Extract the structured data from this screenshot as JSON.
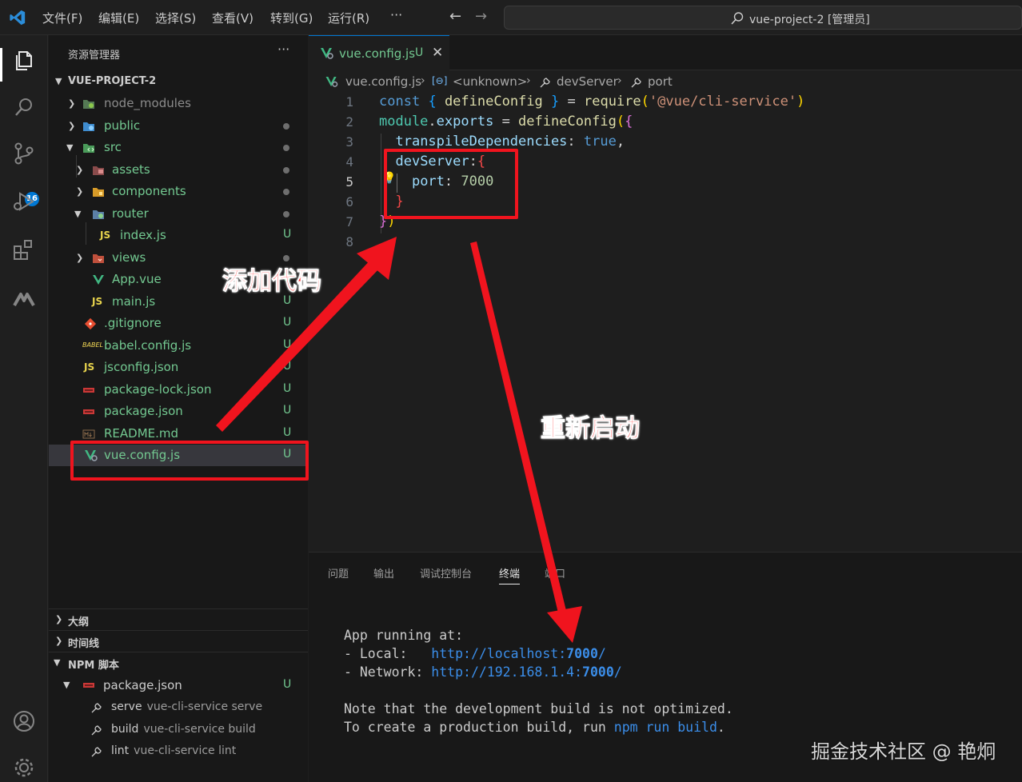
{
  "titlebar": {
    "menu": [
      "文件(F)",
      "编辑(E)",
      "选择(S)",
      "查看(V)",
      "转到(G)",
      "运行(R)"
    ],
    "more": "···",
    "command_center": "vue-project-2 [管理员]"
  },
  "activity": {
    "scm_badge": "16"
  },
  "sidebar": {
    "title": "资源管理器",
    "more": "···",
    "project": "VUE-PROJECT-2",
    "tree": [
      {
        "name": "node_modules",
        "status": ""
      },
      {
        "name": "public",
        "status": "•"
      },
      {
        "name": "src",
        "status": "•"
      },
      {
        "name": "assets",
        "status": "•"
      },
      {
        "name": "components",
        "status": "•"
      },
      {
        "name": "router",
        "status": "•"
      },
      {
        "name": "index.js",
        "status": "U"
      },
      {
        "name": "views",
        "status": "•"
      },
      {
        "name": "App.vue",
        "status": "U"
      },
      {
        "name": "main.js",
        "status": "U"
      },
      {
        "name": ".gitignore",
        "status": "U"
      },
      {
        "name": "babel.config.js",
        "status": "U"
      },
      {
        "name": "jsconfig.json",
        "status": "U"
      },
      {
        "name": "package-lock.json",
        "status": "U"
      },
      {
        "name": "package.json",
        "status": "U"
      },
      {
        "name": "README.md",
        "status": "U"
      },
      {
        "name": "vue.config.js",
        "status": "U"
      }
    ],
    "sections": {
      "outline": "大纲",
      "timeline": "时间线",
      "npm": "NPM 脚本"
    },
    "npm": {
      "file": "package.json",
      "file_status": "U",
      "scripts": [
        {
          "name": "serve",
          "cmd": "vue-cli-service serve"
        },
        {
          "name": "build",
          "cmd": "vue-cli-service build"
        },
        {
          "name": "lint",
          "cmd": "vue-cli-service lint"
        }
      ]
    }
  },
  "editor": {
    "tab": {
      "label": "vue.config.js",
      "status": "U",
      "close": "✕"
    },
    "breadcrumb": [
      "vue.config.js",
      "<unknown>",
      "devServer",
      "port"
    ],
    "line_numbers": [
      "1",
      "2",
      "3",
      "4",
      "5",
      "6",
      "7",
      "8"
    ]
  },
  "panel": {
    "tabs": [
      "问题",
      "输出",
      "调试控制台",
      "终端",
      "端口"
    ],
    "terminal": {
      "running": "App running at:",
      "local_label": "- Local:   ",
      "local_url_a": "http://localhost:",
      "local_port": "7000",
      "local_url_b": "/",
      "network_label": "- Network: ",
      "network_url_a": "http://192.168.1.4:",
      "network_port": "7000",
      "network_url_b": "/",
      "note": "Note that the development build is not optimized.",
      "prod_a": "To create a production build, run ",
      "prod_cmd": "npm run build",
      "prod_b": "."
    }
  },
  "annotations": {
    "add_code": "添加代码",
    "restart": "重新启动"
  },
  "watermark": "掘金技术社区 @ 艳炯",
  "colors": {
    "accent": "#0078d4",
    "untracked": "#73c991",
    "annotation": "#f0141e"
  }
}
